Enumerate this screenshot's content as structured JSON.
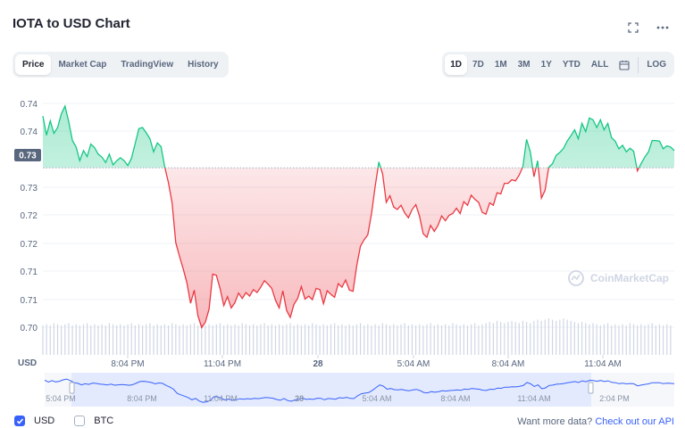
{
  "header": {
    "title": "IOTA to USD Chart"
  },
  "tabs": [
    {
      "label": "Price",
      "active": true
    },
    {
      "label": "Market Cap",
      "active": false
    },
    {
      "label": "TradingView",
      "active": false
    },
    {
      "label": "History",
      "active": false
    }
  ],
  "ranges": [
    {
      "label": "1D",
      "active": true
    },
    {
      "label": "7D",
      "active": false
    },
    {
      "label": "1M",
      "active": false
    },
    {
      "label": "3M",
      "active": false
    },
    {
      "label": "1Y",
      "active": false
    },
    {
      "label": "YTD",
      "active": false
    },
    {
      "label": "ALL",
      "active": false
    }
  ],
  "log_label": "LOG",
  "icons": {
    "fullscreen": "fullscreen-icon",
    "more": "more-icon",
    "calendar": "calendar-icon"
  },
  "colors": {
    "up": "#16c784",
    "down": "#ea3943",
    "accent": "#3861fb",
    "volume": "#cfd6e4"
  },
  "watermark": "CoinMarketCap",
  "legend": [
    {
      "label": "USD",
      "checked": true
    },
    {
      "label": "BTC",
      "checked": false
    }
  ],
  "footer": {
    "text": "Want more data?",
    "link": "Check out our API"
  },
  "chart_data": {
    "type": "line",
    "currency_label": "USD",
    "baseline": 0.731,
    "baseline_label": "0.73",
    "y_ticks": [
      "0.74",
      "0.74",
      "0.73",
      "0.73",
      "0.72",
      "0.72",
      "0.71",
      "0.71",
      "0.70"
    ],
    "x_ticks": [
      "8:04 PM",
      "11:04 PM",
      "28",
      "5:04 AM",
      "8:04 AM",
      "11:04 AM"
    ],
    "navigator_ticks": [
      "5:04 PM",
      "8:04 PM",
      "11:04 PM",
      "28",
      "5:04 AM",
      "8:04 AM",
      "11:04 AM",
      "2:04 PM"
    ],
    "ylim": [
      0.6995,
      0.7435
    ],
    "series": [
      {
        "values": [
          0.7397,
          0.7365,
          0.7389,
          0.7368,
          0.7378,
          0.7401,
          0.7414,
          0.7388,
          0.7356,
          0.7345,
          0.7322,
          0.7339,
          0.7329,
          0.735,
          0.7344,
          0.7333,
          0.7328,
          0.7319,
          0.7333,
          0.7315,
          0.7322,
          0.7327,
          0.7322,
          0.7314,
          0.7326,
          0.7351,
          0.7376,
          0.7378,
          0.7369,
          0.7359,
          0.7337,
          0.7352,
          0.7346,
          0.7312,
          0.7285,
          0.7251,
          0.7184,
          0.7161,
          0.714,
          0.7117,
          0.7082,
          0.7104,
          0.7061,
          0.7041,
          0.705,
          0.7072,
          0.7131,
          0.7129,
          0.7106,
          0.7078,
          0.7093,
          0.7074,
          0.7083,
          0.7099,
          0.709,
          0.71,
          0.7094,
          0.7105,
          0.71,
          0.7109,
          0.712,
          0.7114,
          0.7107,
          0.7087,
          0.7074,
          0.7103,
          0.707,
          0.7058,
          0.708,
          0.709,
          0.711,
          0.7089,
          0.7094,
          0.7088,
          0.7107,
          0.7105,
          0.7081,
          0.7103,
          0.7097,
          0.7092,
          0.7115,
          0.7109,
          0.7121,
          0.7104,
          0.7102,
          0.7145,
          0.7178,
          0.7189,
          0.7197,
          0.7233,
          0.7279,
          0.732,
          0.73,
          0.7252,
          0.7263,
          0.7244,
          0.724,
          0.7247,
          0.7234,
          0.7226,
          0.724,
          0.7248,
          0.7229,
          0.7199,
          0.7193,
          0.7213,
          0.7203,
          0.7213,
          0.7229,
          0.7221,
          0.723,
          0.7233,
          0.7242,
          0.7233,
          0.7253,
          0.7247,
          0.7264,
          0.7257,
          0.7252,
          0.7235,
          0.7232,
          0.7251,
          0.7247,
          0.7268,
          0.7266,
          0.7284,
          0.7284,
          0.729,
          0.7288,
          0.7298,
          0.7312,
          0.7358,
          0.7337,
          0.7295,
          0.7322,
          0.7259,
          0.7272,
          0.7311,
          0.7317,
          0.7331,
          0.7336,
          0.7343,
          0.7355,
          0.7364,
          0.7374,
          0.7359,
          0.7385,
          0.7371,
          0.7394,
          0.7391,
          0.7378,
          0.7391,
          0.7374,
          0.7385,
          0.7361,
          0.7355,
          0.7342,
          0.7348,
          0.7337,
          0.7343,
          0.7338,
          0.7305,
          0.7317,
          0.7328,
          0.7337,
          0.7356,
          0.7356,
          0.7355,
          0.7342,
          0.7347,
          0.7345,
          0.7339
        ]
      }
    ],
    "volume": [
      0.7,
      0.71,
      0.7,
      0.72,
      0.71,
      0.7,
      0.71,
      0.72,
      0.7,
      0.71,
      0.7,
      0.71,
      0.72,
      0.7,
      0.71,
      0.7,
      0.71,
      0.7,
      0.72,
      0.71,
      0.7,
      0.71,
      0.7,
      0.71,
      0.72,
      0.7,
      0.71,
      0.7,
      0.71,
      0.72,
      0.7,
      0.71,
      0.7,
      0.71,
      0.7,
      0.72,
      0.71,
      0.7,
      0.71,
      0.7,
      0.71,
      0.72,
      0.7,
      0.71,
      0.7,
      0.71,
      0.7,
      0.71,
      0.72,
      0.7,
      0.71,
      0.7,
      0.71,
      0.7,
      0.72,
      0.71,
      0.7,
      0.71,
      0.7,
      0.71,
      0.72,
      0.7,
      0.71,
      0.7,
      0.71,
      0.7,
      0.71,
      0.72,
      0.7,
      0.71,
      0.7,
      0.71,
      0.7,
      0.72,
      0.71,
      0.7,
      0.71,
      0.7,
      0.71,
      0.72,
      0.7,
      0.71,
      0.7,
      0.71,
      0.7,
      0.71,
      0.72,
      0.7,
      0.71,
      0.7,
      0.71,
      0.7,
      0.72,
      0.71,
      0.7,
      0.71,
      0.7,
      0.71,
      0.72,
      0.7,
      0.71,
      0.7,
      0.71,
      0.7,
      0.71,
      0.72,
      0.7,
      0.71,
      0.7,
      0.71,
      0.7,
      0.72,
      0.71,
      0.7,
      0.71,
      0.7,
      0.71,
      0.72,
      0.7,
      0.71,
      0.72,
      0.73,
      0.72,
      0.74,
      0.73,
      0.72,
      0.73,
      0.74,
      0.73,
      0.72,
      0.74,
      0.73,
      0.72,
      0.74,
      0.75,
      0.74,
      0.75,
      0.76,
      0.75,
      0.74,
      0.75,
      0.76,
      0.75,
      0.74,
      0.73,
      0.72,
      0.73,
      0.72,
      0.71,
      0.72,
      0.71,
      0.7,
      0.71,
      0.72,
      0.7,
      0.71,
      0.7,
      0.71,
      0.7,
      0.72,
      0.71,
      0.7,
      0.71,
      0.7,
      0.71,
      0.72,
      0.7,
      0.71,
      0.7,
      0.71,
      0.7
    ]
  }
}
